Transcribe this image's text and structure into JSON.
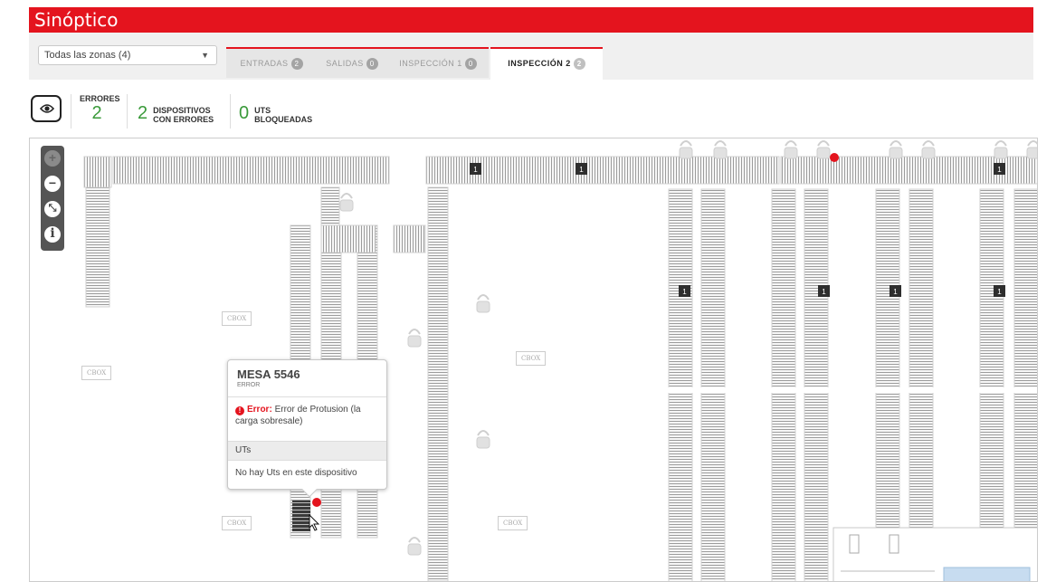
{
  "app": {
    "title": "Sinóptico"
  },
  "zone_select": {
    "value": "Todas las zonas (4)"
  },
  "tabs": [
    {
      "label": "ENTRADAS",
      "count": "2",
      "active": false
    },
    {
      "label": "SALIDAS",
      "count": "0",
      "active": false
    },
    {
      "label": "INSPECCIÓN 1",
      "count": "0",
      "active": false
    },
    {
      "label": "INSPECCIÓN 2",
      "count": "2",
      "active": true
    }
  ],
  "stats": {
    "errors_label": "ERRORES",
    "errors_value": "2",
    "devices_value": "2",
    "devices_label_1": "DISPOSITIVOS",
    "devices_label_2": "CON ERRORES",
    "uts_value": "0",
    "uts_label_1": "UTS",
    "uts_label_2": "BLOQUEADAS"
  },
  "zoom": {
    "zoom_in": "+",
    "zoom_out": "−",
    "fit": "⤡",
    "info": "i"
  },
  "popup": {
    "title": "MESA 5546",
    "status": "ERROR",
    "error_prefix": "Error:",
    "error_text": "Error de Protusion (la carga sobresale)",
    "uts_header": "UTs",
    "uts_empty": "No hay Uts en este dispositivo"
  },
  "map_labels": {
    "cbox": "CBOX",
    "marker_count": "1"
  },
  "colors": {
    "brand": "#e4141e",
    "ok": "#3a9a3a",
    "error": "#e4141e"
  },
  "icons": [
    "eye-icon",
    "zoom-in-icon",
    "zoom-out-icon",
    "fit-icon",
    "info-icon",
    "cursor-hand-icon",
    "error-icon"
  ]
}
